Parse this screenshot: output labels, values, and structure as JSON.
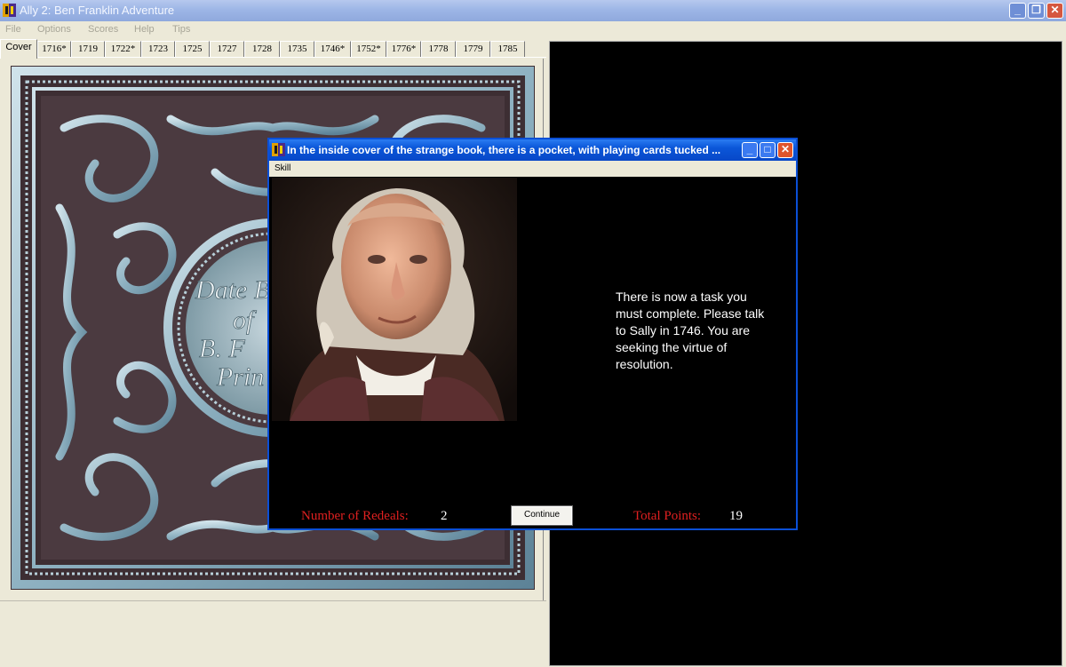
{
  "window": {
    "title": "Ally 2: Ben Franklin Adventure",
    "controls": {
      "minimize": "_",
      "restore": "❐",
      "close": "✕"
    }
  },
  "menubar": [
    "File",
    "Options",
    "Scores",
    "Help",
    "Tips"
  ],
  "tabs": [
    "Cover",
    "1716*",
    "1719",
    "1722*",
    "1723",
    "1725",
    "1727",
    "1728",
    "1735",
    "1746*",
    "1752*",
    "1776*",
    "1778",
    "1779",
    "1785"
  ],
  "active_tab": "Cover",
  "cover": {
    "text_lines": [
      "Date B",
      "of",
      "B. F",
      "Prin"
    ]
  },
  "dialog": {
    "title": "In the inside cover of the strange book, there is a pocket, with playing cards tucked ...",
    "controls": {
      "minimize": "_",
      "maximize": "□",
      "close": "✕"
    },
    "menu": "Skill",
    "message": "There is now a task you must complete.  Please talk to Sally in 1746.  You are seeking the virtue of resolution.",
    "redeals_label": "Number of Redeals:",
    "redeals_value": "2",
    "continue_label": "Continue",
    "points_label": "Total Points:",
    "points_value": "19"
  },
  "colors": {
    "title_bar": "#9db6e6",
    "dialog_title_bar": "#0a56d8",
    "stat_label": "#e02020",
    "panel": "#ece9d8"
  }
}
